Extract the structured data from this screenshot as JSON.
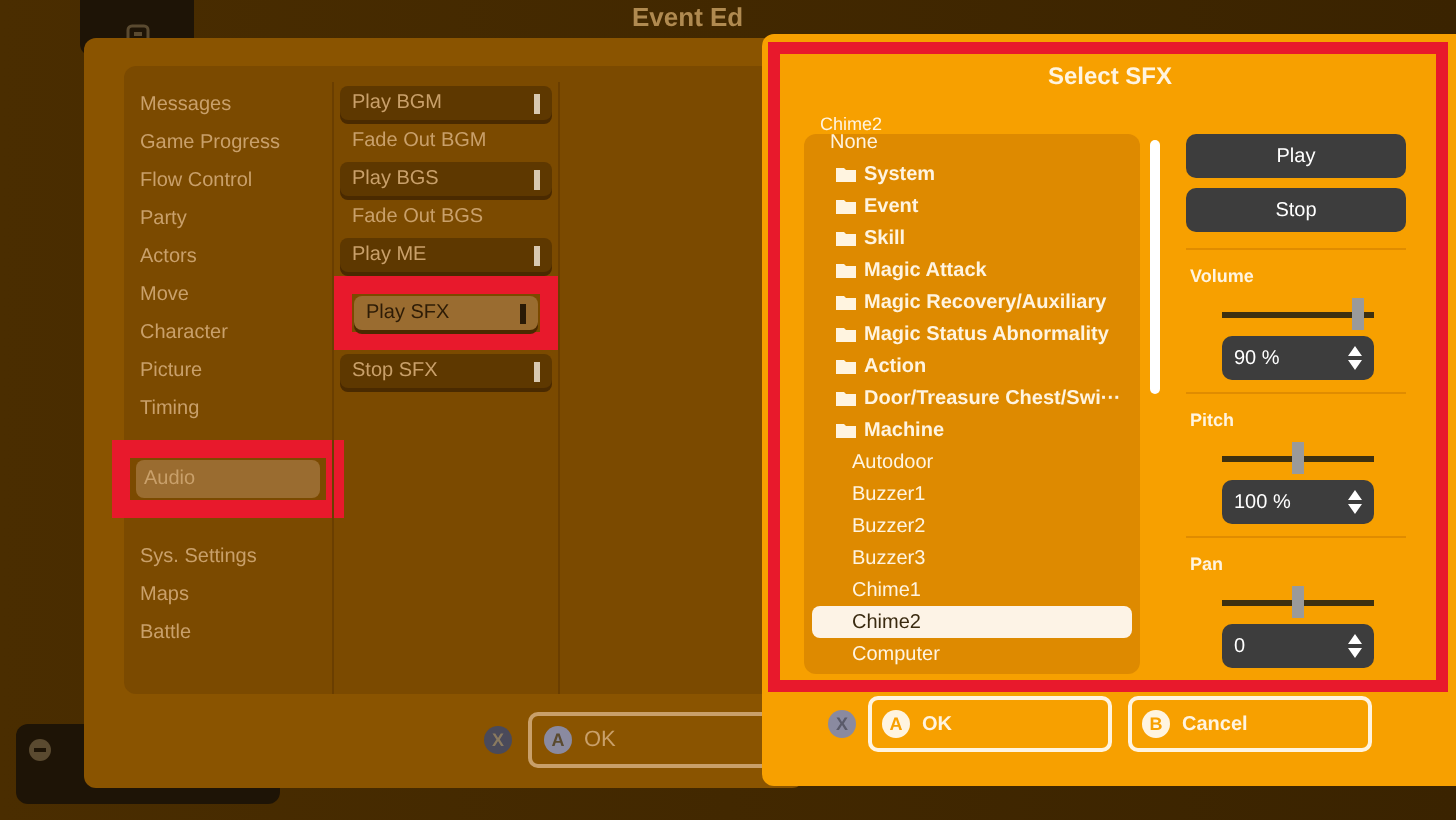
{
  "background": {
    "title": "Event Ed"
  },
  "event_editor": {
    "categories": [
      {
        "label": "Messages",
        "selected": false
      },
      {
        "label": "Game Progress",
        "selected": false
      },
      {
        "label": "Flow Control",
        "selected": false
      },
      {
        "label": "Party",
        "selected": false
      },
      {
        "label": "Actors",
        "selected": false
      },
      {
        "label": "Move",
        "selected": false
      },
      {
        "label": "Character",
        "selected": false
      },
      {
        "label": "Picture",
        "selected": false
      },
      {
        "label": "Timing",
        "selected": false
      },
      {
        "label": "Audio",
        "selected": true
      },
      {
        "label": "Sys. Settings",
        "selected": false
      },
      {
        "label": "Maps",
        "selected": false
      },
      {
        "label": "Battle",
        "selected": false
      }
    ],
    "commands": [
      {
        "label": "Play BGM",
        "kind": "button",
        "selected": false
      },
      {
        "label": "Fade Out BGM",
        "kind": "plain",
        "selected": false
      },
      {
        "label": "Play BGS",
        "kind": "button",
        "selected": false
      },
      {
        "label": "Fade Out BGS",
        "kind": "plain",
        "selected": false
      },
      {
        "label": "Play ME",
        "kind": "button",
        "selected": false
      },
      {
        "label": "Play SFX",
        "kind": "button",
        "selected": true
      },
      {
        "label": "Stop SFX",
        "kind": "button",
        "selected": false
      }
    ],
    "close_key": "X",
    "ok_button": {
      "key": "A",
      "label": "OK"
    }
  },
  "select_sfx": {
    "title": "Select SFX",
    "current": "Chime2",
    "items": [
      {
        "label": "None",
        "kind": "none",
        "selected": false
      },
      {
        "label": "System",
        "kind": "folder",
        "selected": false
      },
      {
        "label": "Event",
        "kind": "folder",
        "selected": false
      },
      {
        "label": "Skill",
        "kind": "folder",
        "selected": false
      },
      {
        "label": "Magic Attack",
        "kind": "folder",
        "selected": false
      },
      {
        "label": "Magic Recovery/Auxiliary",
        "kind": "folder",
        "selected": false
      },
      {
        "label": "Magic Status Abnormality",
        "kind": "folder",
        "selected": false
      },
      {
        "label": "Action",
        "kind": "folder",
        "selected": false
      },
      {
        "label": "Door/Treasure Chest/Swi···",
        "kind": "folder",
        "selected": false
      },
      {
        "label": "Machine",
        "kind": "folder",
        "selected": false
      },
      {
        "label": "Autodoor",
        "kind": "file",
        "selected": false
      },
      {
        "label": "Buzzer1",
        "kind": "file",
        "selected": false
      },
      {
        "label": "Buzzer2",
        "kind": "file",
        "selected": false
      },
      {
        "label": "Buzzer3",
        "kind": "file",
        "selected": false
      },
      {
        "label": "Chime1",
        "kind": "file",
        "selected": false
      },
      {
        "label": "Chime2",
        "kind": "file",
        "selected": true
      },
      {
        "label": "Computer",
        "kind": "file",
        "selected": false
      }
    ],
    "play_button": "Play",
    "stop_button": "Stop",
    "controls": [
      {
        "label": "Volume",
        "level": 0.9,
        "value": "90 %"
      },
      {
        "label": "Pitch",
        "level": 0.5,
        "value": "100 %"
      },
      {
        "label": "Pan",
        "level": 0.5,
        "value": "0"
      }
    ],
    "close_key": "X",
    "buttons": [
      {
        "key": "A",
        "label": "OK"
      },
      {
        "key": "B",
        "label": "Cancel"
      }
    ]
  }
}
